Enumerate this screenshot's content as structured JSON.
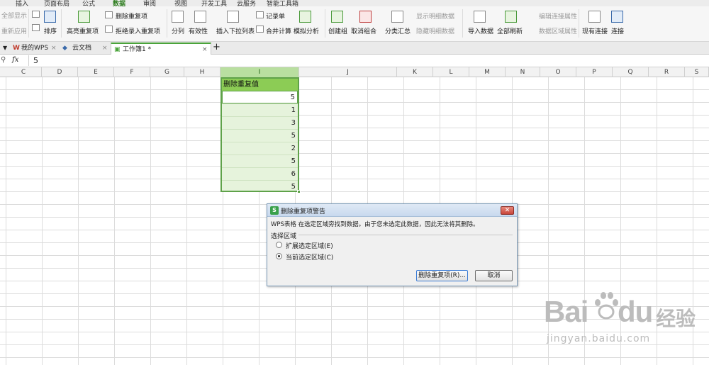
{
  "menu": {
    "items": [
      "插入",
      "页面布局",
      "公式",
      "数据",
      "审阅",
      "视图",
      "开发工具",
      "云服务",
      "智能工具箱"
    ],
    "active": "数据"
  },
  "ribbon": {
    "show_all": "全部显示",
    "reapply": "重新应用",
    "sort": "排序",
    "highlight_dup": "高亮重复项",
    "remove_dup": "删除重复项",
    "reject_dup": "拒绝录入重复项",
    "split": "分列",
    "validity": "有效性",
    "dropdown": "插入下拉列表",
    "records": "记录单",
    "consolidate": "合并计算",
    "simulate": "模拟分析",
    "group": "创建组",
    "ungroup": "取消组合",
    "subtotal": "分类汇总",
    "show_detail": "显示明细数据",
    "hide_detail": "隐藏明细数据",
    "import": "导入数据",
    "refresh_all": "全部刷新",
    "edit_conn": "编辑连接属性",
    "range_props": "数据区域属性",
    "existing_conn": "现有连接",
    "connect": "连接"
  },
  "tabs": {
    "my_wps": "我的WPS",
    "cloud": "云文档",
    "workbook": "工作簿1 *",
    "add": "+",
    "close": "×"
  },
  "formula_bar": {
    "cell_ref": "fx",
    "value": "5"
  },
  "columns": [
    "C",
    "D",
    "E",
    "F",
    "G",
    "H",
    "I",
    "J",
    "K",
    "L",
    "M",
    "N",
    "O",
    "P",
    "Q",
    "R",
    "S"
  ],
  "data_column": {
    "header": "删除重复值",
    "values": [
      "5",
      "1",
      "3",
      "5",
      "2",
      "5",
      "6",
      "5"
    ]
  },
  "dialog": {
    "title": "删除重复项警告",
    "message": "WPS表格 在选定区域旁找到数据。由于您未选定此数据，因此无法将其删除。",
    "group_label": "选择区域",
    "option_expand": "扩展选定区域(E)",
    "option_current": "当前选定区域(C)",
    "selected_option": "option_current",
    "btn_remove": "删除重复项(R)...",
    "btn_cancel": "取消"
  },
  "watermark": {
    "brand": "Bai",
    "brand2": "du",
    "cn": "经验",
    "url": "jingyan.baidu.com"
  },
  "colors": {
    "accent": "#4aa33a",
    "header_fill": "#8ccc55",
    "selection_fill": "#e6f3dc"
  }
}
